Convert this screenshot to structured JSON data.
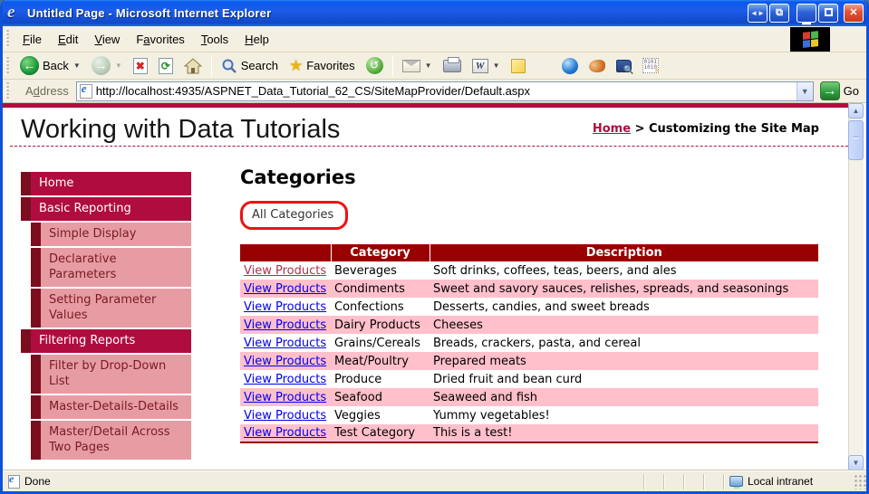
{
  "window": {
    "title": "Untitled Page - Microsoft Internet Explorer",
    "controls": [
      {
        "name": "pan-arrows-button",
        "glyph": "◄►"
      },
      {
        "name": "detach-window-button",
        "glyph": "⧉"
      },
      {
        "name": "minimize-button",
        "glyph": "_"
      },
      {
        "name": "maximize-button",
        "glyph": "□"
      },
      {
        "name": "close-button",
        "glyph": "✕"
      }
    ]
  },
  "menu_bar": {
    "items": [
      {
        "label": "File",
        "u": 0
      },
      {
        "label": "Edit",
        "u": 0
      },
      {
        "label": "View",
        "u": 0
      },
      {
        "label": "Favorites",
        "u": 1
      },
      {
        "label": "Tools",
        "u": 0
      },
      {
        "label": "Help",
        "u": 0
      }
    ]
  },
  "toolbar": {
    "back_label": "Back",
    "search_label": "Search",
    "favorites_label": "Favorites",
    "icons": [
      "back-icon",
      "forward-icon",
      "stop-icon",
      "refresh-icon",
      "home-icon",
      "search-icon",
      "favorites-star-icon",
      "history-icon",
      "mail-icon",
      "print-icon",
      "edit-word-icon",
      "notes-icon",
      "messenger-icon",
      "fox-addon-icon",
      "research-icon",
      "script-debug-icon"
    ]
  },
  "address_bar": {
    "label": "Address",
    "label_underline": "d",
    "url": "http://localhost:4935/ASPNET_Data_Tutorial_62_CS/SiteMapProvider/Default.aspx",
    "go_label": "Go"
  },
  "page": {
    "site_title": "Working with Data Tutorials",
    "breadcrumb": {
      "home": "Home",
      "separator": " > ",
      "current": "Customizing the Site Map"
    },
    "sidebar": {
      "items": [
        {
          "label": "Home",
          "level": 0
        },
        {
          "label": "Basic Reporting",
          "level": 0
        },
        {
          "label": "Simple Display",
          "level": 1
        },
        {
          "label": "Declarative Parameters",
          "level": 1
        },
        {
          "label": "Setting Parameter Values",
          "level": 1
        },
        {
          "label": "Filtering Reports",
          "level": 0
        },
        {
          "label": "Filter by Drop-Down List",
          "level": 1
        },
        {
          "label": "Master-Details-Details",
          "level": 1
        },
        {
          "label": "Master/Detail Across Two Pages",
          "level": 1
        }
      ]
    },
    "main": {
      "heading": "Categories",
      "filter_label": "All Categories",
      "table": {
        "headers": [
          "",
          "Category",
          "Description"
        ],
        "link_label": "View Products",
        "rows": [
          {
            "category": "Beverages",
            "description": "Soft drinks, coffees, teas, beers, and ales",
            "visited": true
          },
          {
            "category": "Condiments",
            "description": "Sweet and savory sauces, relishes, spreads, and seasonings",
            "visited": false
          },
          {
            "category": "Confections",
            "description": "Desserts, candies, and sweet breads",
            "visited": false
          },
          {
            "category": "Dairy Products",
            "description": "Cheeses",
            "visited": false
          },
          {
            "category": "Grains/Cereals",
            "description": "Breads, crackers, pasta, and cereal",
            "visited": false
          },
          {
            "category": "Meat/Poultry",
            "description": "Prepared meats",
            "visited": false
          },
          {
            "category": "Produce",
            "description": "Dried fruit and bean curd",
            "visited": false
          },
          {
            "category": "Seafood",
            "description": "Seaweed and fish",
            "visited": false
          },
          {
            "category": "Veggies",
            "description": "Yummy vegetables!",
            "visited": false
          },
          {
            "category": "Test Category",
            "description": "This is a test!",
            "visited": false
          }
        ]
      }
    }
  },
  "status_bar": {
    "status": "Done",
    "zone": "Local intranet"
  },
  "colors": {
    "accent_crimson": "#b00d3f",
    "maroon_strip": "#7a0e1f",
    "sidebar_sub_pink": "#e79ca3",
    "sidebar_sub_text": "#7a1a26",
    "table_header_red": "#990000",
    "alt_row_pink": "#ffc0cb",
    "link_blue": "#0000ee",
    "visited_link": "#a8334c",
    "annotation_red": "#ee1111",
    "titlebar_blue": "#1c5ce8"
  }
}
